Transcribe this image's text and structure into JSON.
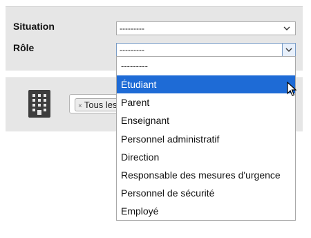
{
  "form": {
    "situation_label": "Situation",
    "situation_value": "---------",
    "role_label": "Rôle",
    "role_value": "---------"
  },
  "role_options": [
    "---------",
    "Étudiant",
    "Parent",
    "Enseignant",
    "Personnel administratif",
    "Direction",
    "Responsable des mesures d'urgence",
    "Personnel de sécurité",
    "Employé"
  ],
  "highlighted_option": "Étudiant",
  "building_filter": {
    "icon": "building-icon",
    "tag_remove": "×",
    "tag_label": "Tous les"
  },
  "colors": {
    "highlight": "#1e6bd6",
    "panel": "#e6e6e6"
  }
}
